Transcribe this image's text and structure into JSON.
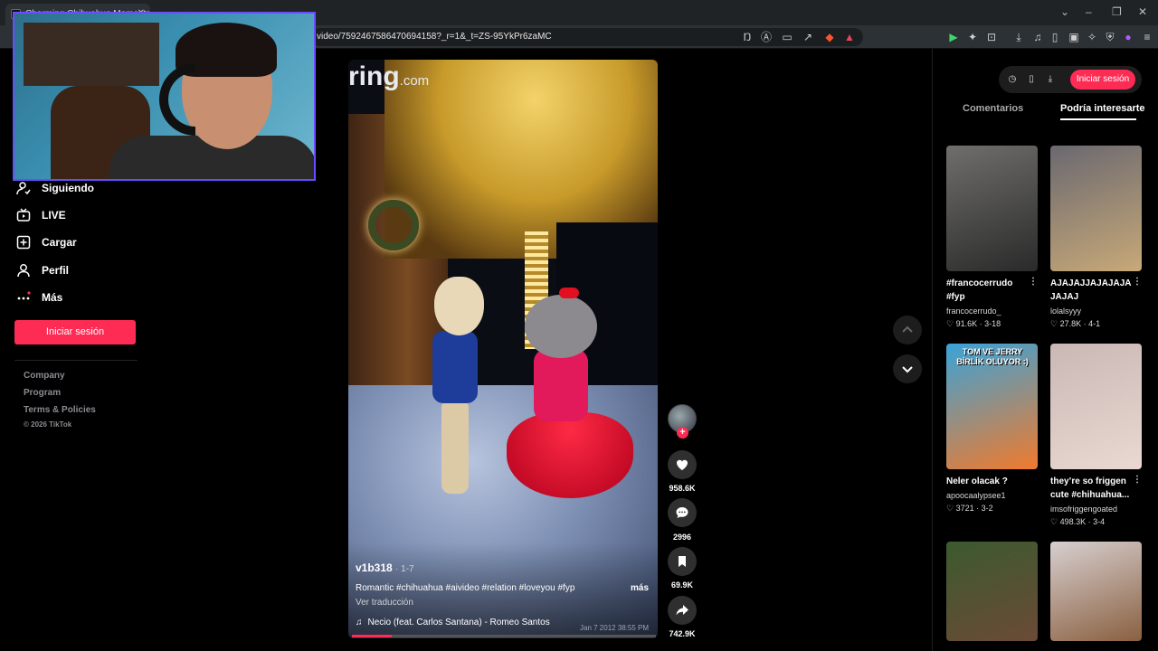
{
  "browser": {
    "tab_title": "Charming Chihuahua Moments",
    "url": "video/7592467586470694158?_r=1&_t=ZS-95YkPr6zaMC"
  },
  "nav": {
    "items": [
      {
        "label": "Siguiendo",
        "icon": "following-icon"
      },
      {
        "label": "LIVE",
        "icon": "live-icon"
      },
      {
        "label": "Cargar",
        "icon": "upload-icon"
      },
      {
        "label": "Perfil",
        "icon": "profile-icon"
      },
      {
        "label": "Más",
        "icon": "more-dots-icon"
      }
    ],
    "login_label": "Iniciar sesión",
    "footer_links": [
      "Company",
      "Program",
      "Terms & Policies"
    ],
    "copyright": "© 2026 TikTok"
  },
  "video": {
    "brand": "ring",
    "brand_suffix": ".com",
    "author": "v1b318",
    "date": "· 1-7",
    "caption": "Romantic #chihuahua #aivideo #relation #loveyou #fyp",
    "more": "más",
    "translate": "Ver traducción",
    "music_icon": "♫",
    "music": "Necio (feat. Carlos Santana) - Romeo Santos",
    "timestamp": "Jan 7 2012  38:55 PM",
    "progress_fraction": 0.13,
    "likes": "958.6K",
    "comments": "2996",
    "saves": "69.9K",
    "shares": "742.9K"
  },
  "right_panel": {
    "signin_label": "Iniciar sesión",
    "tabs": [
      "Comentarios",
      "Podría interesarte"
    ],
    "active_tab": 1,
    "cards": [
      {
        "title": "#francocerrudo #fyp",
        "user": "francocerrudo_",
        "stats": "91.6K · 3-18",
        "thumb_colors": [
          "#6f6e6c",
          "#2a2a2a"
        ]
      },
      {
        "title": "AJAJAJJAJAJAJA JAJAJ",
        "user": "lolalsyyy",
        "stats": "27.8K · 4-1",
        "thumb_colors": [
          "#6a6870",
          "#c8a978"
        ]
      },
      {
        "title": "Neler olacak ?",
        "user": "apoocaalypsee1",
        "stats": "3721 · 3-2",
        "thumb_colors": [
          "#3aa3d8",
          "#f07a2c"
        ]
      },
      {
        "title": "they’re so friggen cute #chihuahua...",
        "user": "imsofriggengoated",
        "stats": "498.3K · 3-4",
        "thumb_colors": [
          "#c9b8b4",
          "#ead8d2"
        ]
      },
      {
        "title": "",
        "user": "",
        "stats": "",
        "thumb_colors": [
          "#3c5a2e",
          "#6b4a36"
        ]
      },
      {
        "title": "",
        "user": "",
        "stats": "",
        "thumb_colors": [
          "#d7cfd0",
          "#8a6040"
        ]
      }
    ],
    "card_overlay_text": "TOM VE JERRY BİRLİK OLUYOR :)"
  },
  "colors": {
    "accent": "#fe2c55",
    "webcam_border": "#6b4bff"
  }
}
